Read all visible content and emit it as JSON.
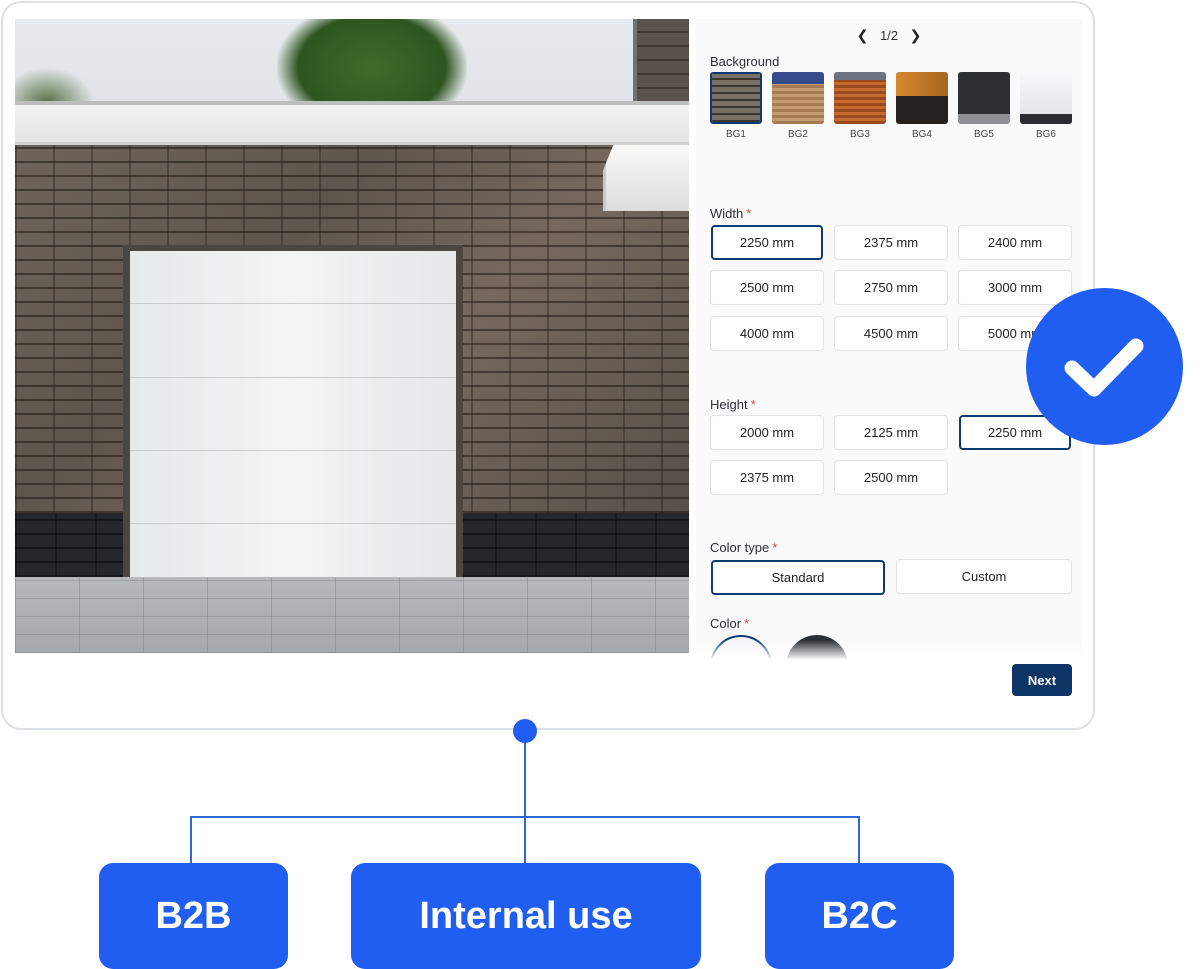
{
  "pager": {
    "label": "1/2",
    "prev_icon": "chevron-left-icon",
    "next_icon": "chevron-right-icon"
  },
  "background": {
    "label": "Background",
    "selected": "BG1",
    "options": [
      {
        "caption": "BG1",
        "color": "#6a625a"
      },
      {
        "caption": "BG2",
        "color": "#b88d63"
      },
      {
        "caption": "BG3",
        "color": "#b05a25"
      },
      {
        "caption": "BG4",
        "color": "#2b2622"
      },
      {
        "caption": "BG5",
        "color": "#2f3033"
      },
      {
        "caption": "BG6",
        "color": "#eef0f1"
      }
    ]
  },
  "width": {
    "label": "Width",
    "required_mark": "*",
    "selected": "2250 mm",
    "options": [
      "2250 mm",
      "2375 mm",
      "2400 mm",
      "2500 mm",
      "2750 mm",
      "3000 mm",
      "4000 mm",
      "4500 mm",
      "5000 mm"
    ]
  },
  "height": {
    "label": "Height",
    "required_mark": "*",
    "selected": "2250 mm",
    "options": [
      "2000 mm",
      "2125 mm",
      "2250 mm",
      "2375 mm",
      "2500 mm"
    ]
  },
  "color_type": {
    "label": "Color type",
    "required_mark": "*",
    "selected": "Standard",
    "options": [
      "Standard",
      "Custom"
    ]
  },
  "color": {
    "label": "Color",
    "required_mark": "*",
    "swatches": [
      "#f5f6f7",
      "#2b2f33"
    ],
    "selected_index": 0
  },
  "next_button": "Next",
  "badge": {
    "icon": "checkmark-icon",
    "color": "#1f5ef0"
  },
  "audiences": [
    "B2B",
    "Internal use",
    "B2C"
  ],
  "colors": {
    "accent": "#1f5ef0",
    "primary": "#0d3566"
  }
}
